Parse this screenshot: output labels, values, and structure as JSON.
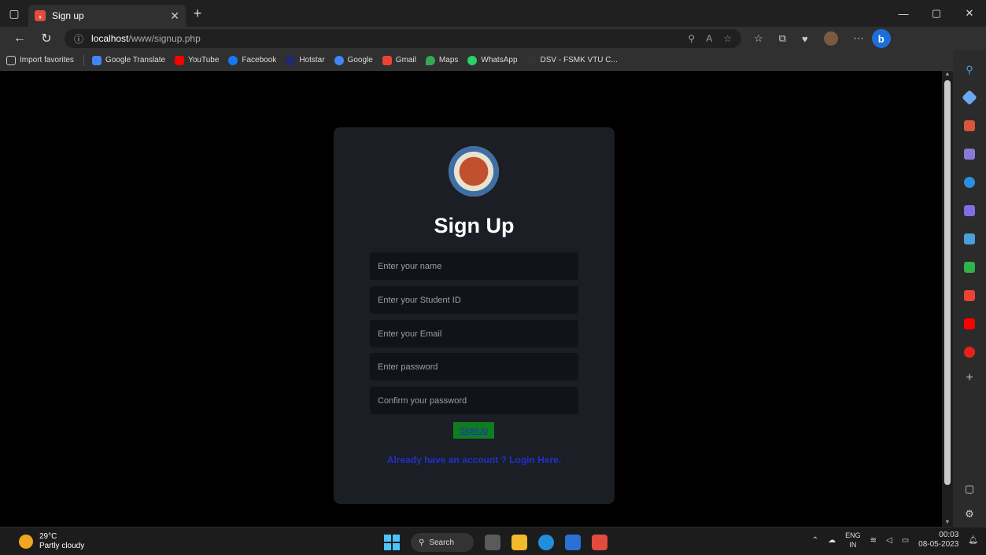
{
  "browser": {
    "tab_title": "Sign up",
    "url_host": "localhost",
    "url_path": "/www/signup.php",
    "favorites": [
      {
        "label": "Import favorites",
        "color": "#cccccc"
      },
      {
        "label": "Google Translate",
        "color": "#4285f4"
      },
      {
        "label": "YouTube",
        "color": "#ff0000"
      },
      {
        "label": "Facebook",
        "color": "#1877f2"
      },
      {
        "label": "Hotstar",
        "color": "#1f2a6b"
      },
      {
        "label": "Google",
        "color": "#4285f4"
      },
      {
        "label": "Gmail",
        "color": "#ea4335"
      },
      {
        "label": "Maps",
        "color": "#34a853"
      },
      {
        "label": "WhatsApp",
        "color": "#25d366"
      },
      {
        "label": "DSV - FSMK VTU C...",
        "color": "#333333"
      }
    ]
  },
  "form": {
    "heading": "Sign Up",
    "name_placeholder": "Enter your name",
    "student_id_placeholder": "Enter your Student ID",
    "email_placeholder": "Enter your Email",
    "password_placeholder": "Enter password",
    "confirm_placeholder": "Confirm your password",
    "submit_label": "SignUp",
    "login_link": "Already have an account ? Login Here."
  },
  "taskbar": {
    "temperature": "29°C",
    "weather": "Partly cloudy",
    "search_label": "Search",
    "lang_top": "ENG",
    "lang_bottom": "IN",
    "time": "00:03",
    "date": "08-05-2023"
  },
  "colors": {
    "card_bg": "#1b1e24",
    "button_bg": "#0f7d1e",
    "link": "#2130c9"
  }
}
